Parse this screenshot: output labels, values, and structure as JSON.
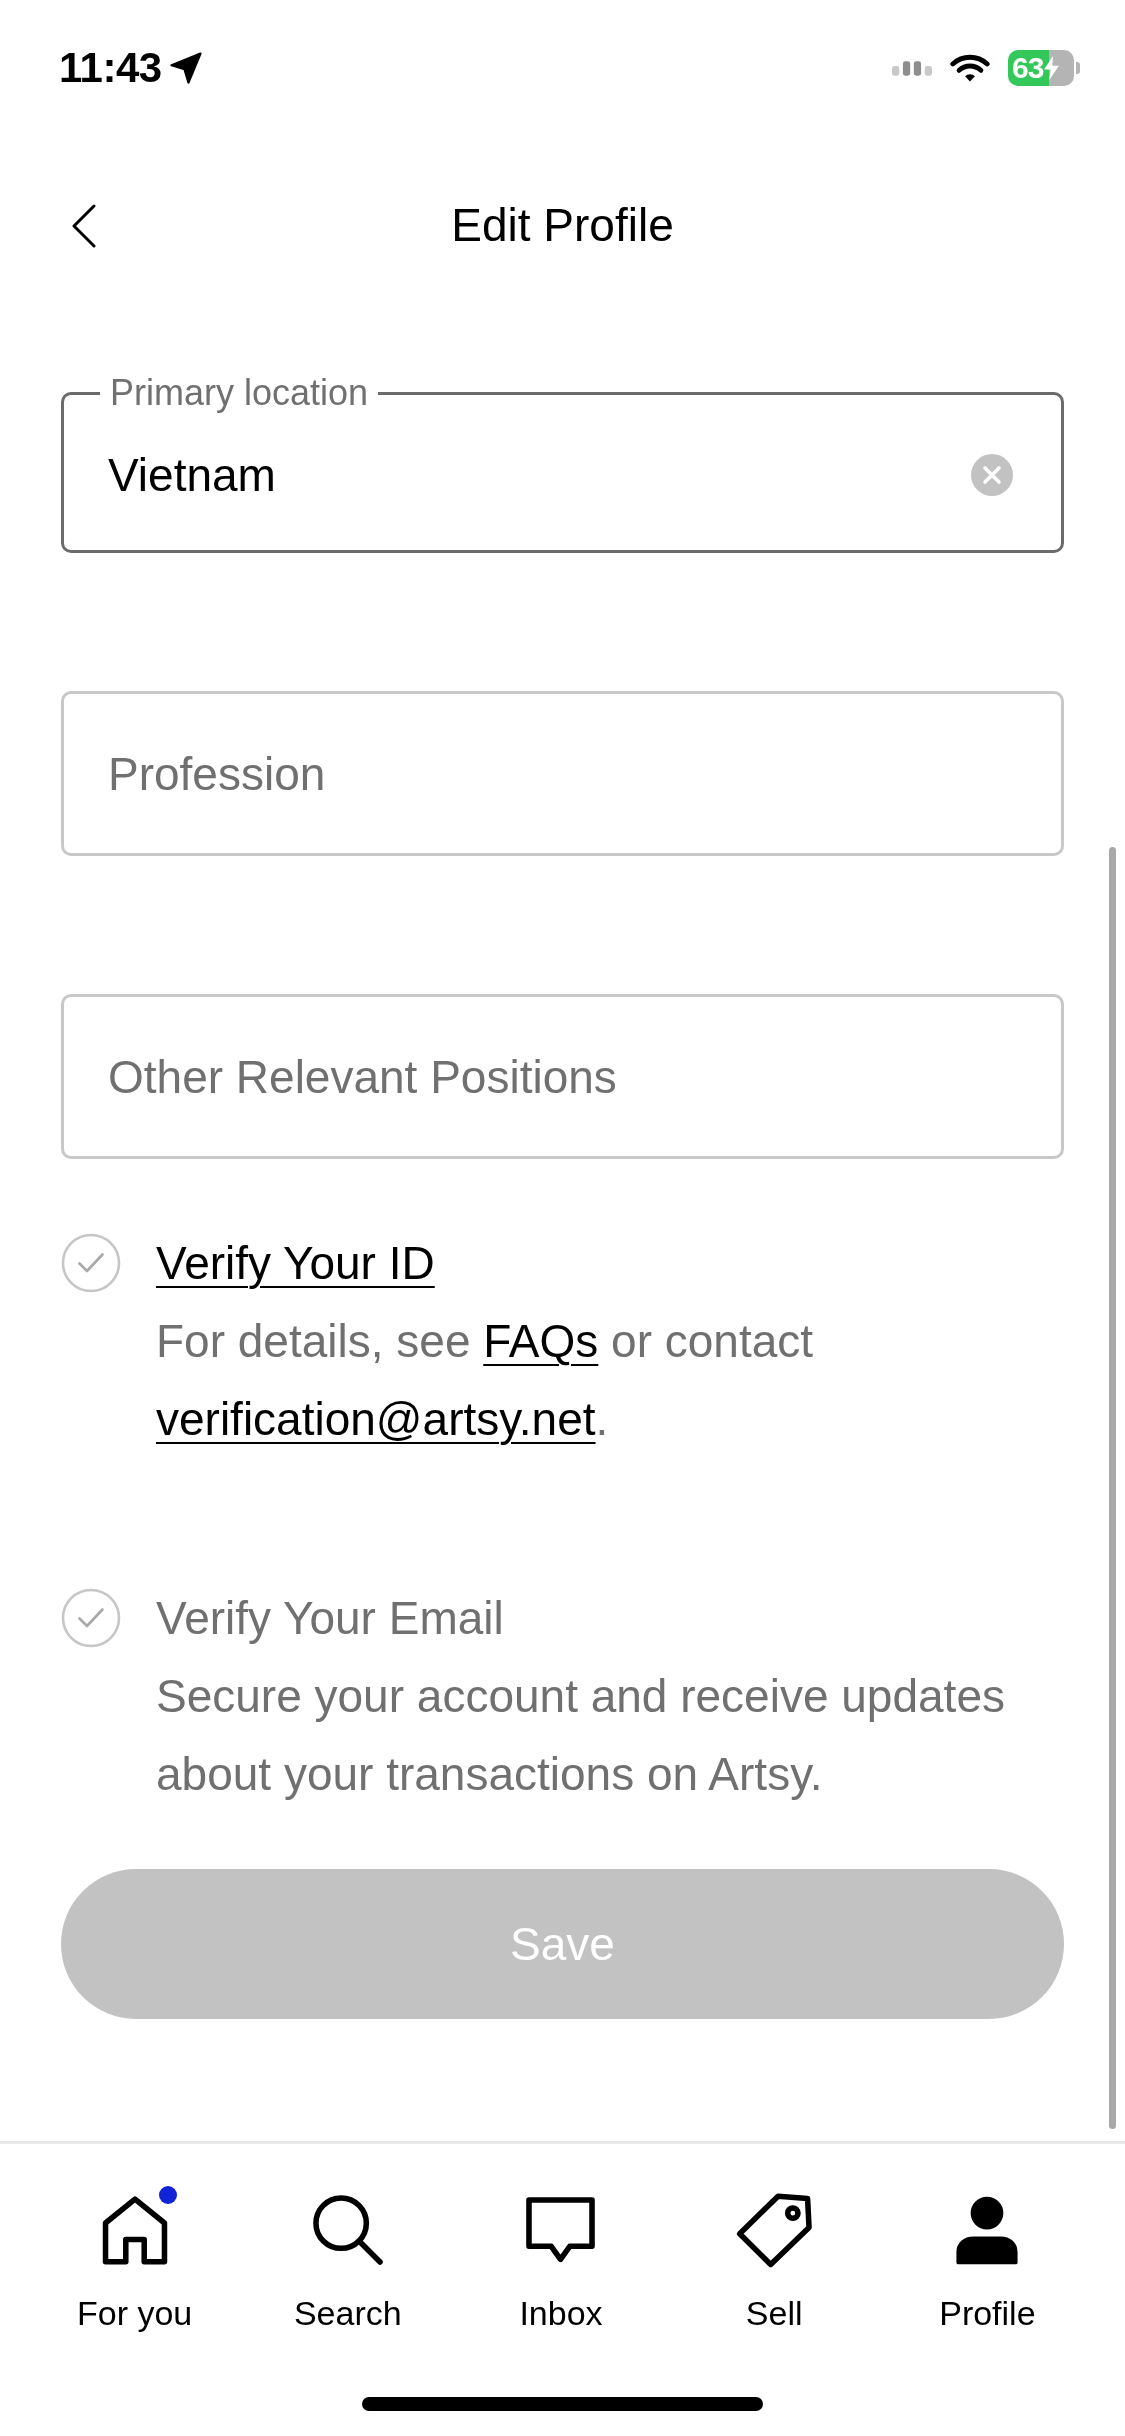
{
  "status_bar": {
    "time": "11:43",
    "battery": "63",
    "charging": true
  },
  "header": {
    "title": "Edit Profile"
  },
  "fields": [
    {
      "label": "Primary location",
      "value": "Vietnam"
    },
    {
      "placeholder": "Profession"
    },
    {
      "placeholder": "Other Relevant Positions"
    }
  ],
  "verifications": [
    {
      "title": "Verify Your ID",
      "title_link": true,
      "checked": false,
      "description": [
        {
          "kind": "text",
          "text": "For details, see "
        },
        {
          "kind": "link",
          "text": "FAQs"
        },
        {
          "kind": "text",
          "text": " or contact "
        },
        {
          "kind": "link",
          "text": "verification@artsy.net"
        },
        {
          "kind": "text",
          "text": "."
        }
      ]
    },
    {
      "title": "Verify Your Email",
      "title_link": false,
      "checked": false,
      "description": [
        {
          "kind": "text",
          "text": "Secure your account and receive updates about your transactions on Artsy."
        }
      ]
    }
  ],
  "save_button": {
    "label": "Save",
    "disabled": true
  },
  "tabs": [
    {
      "label": "For you",
      "selected": false,
      "dot": true
    },
    {
      "label": "Search",
      "selected": false,
      "dot": false
    },
    {
      "label": "Inbox",
      "selected": false,
      "dot": false
    },
    {
      "label": "Sell",
      "selected": false,
      "dot": false
    },
    {
      "label": "Profile",
      "selected": true,
      "dot": false
    }
  ]
}
